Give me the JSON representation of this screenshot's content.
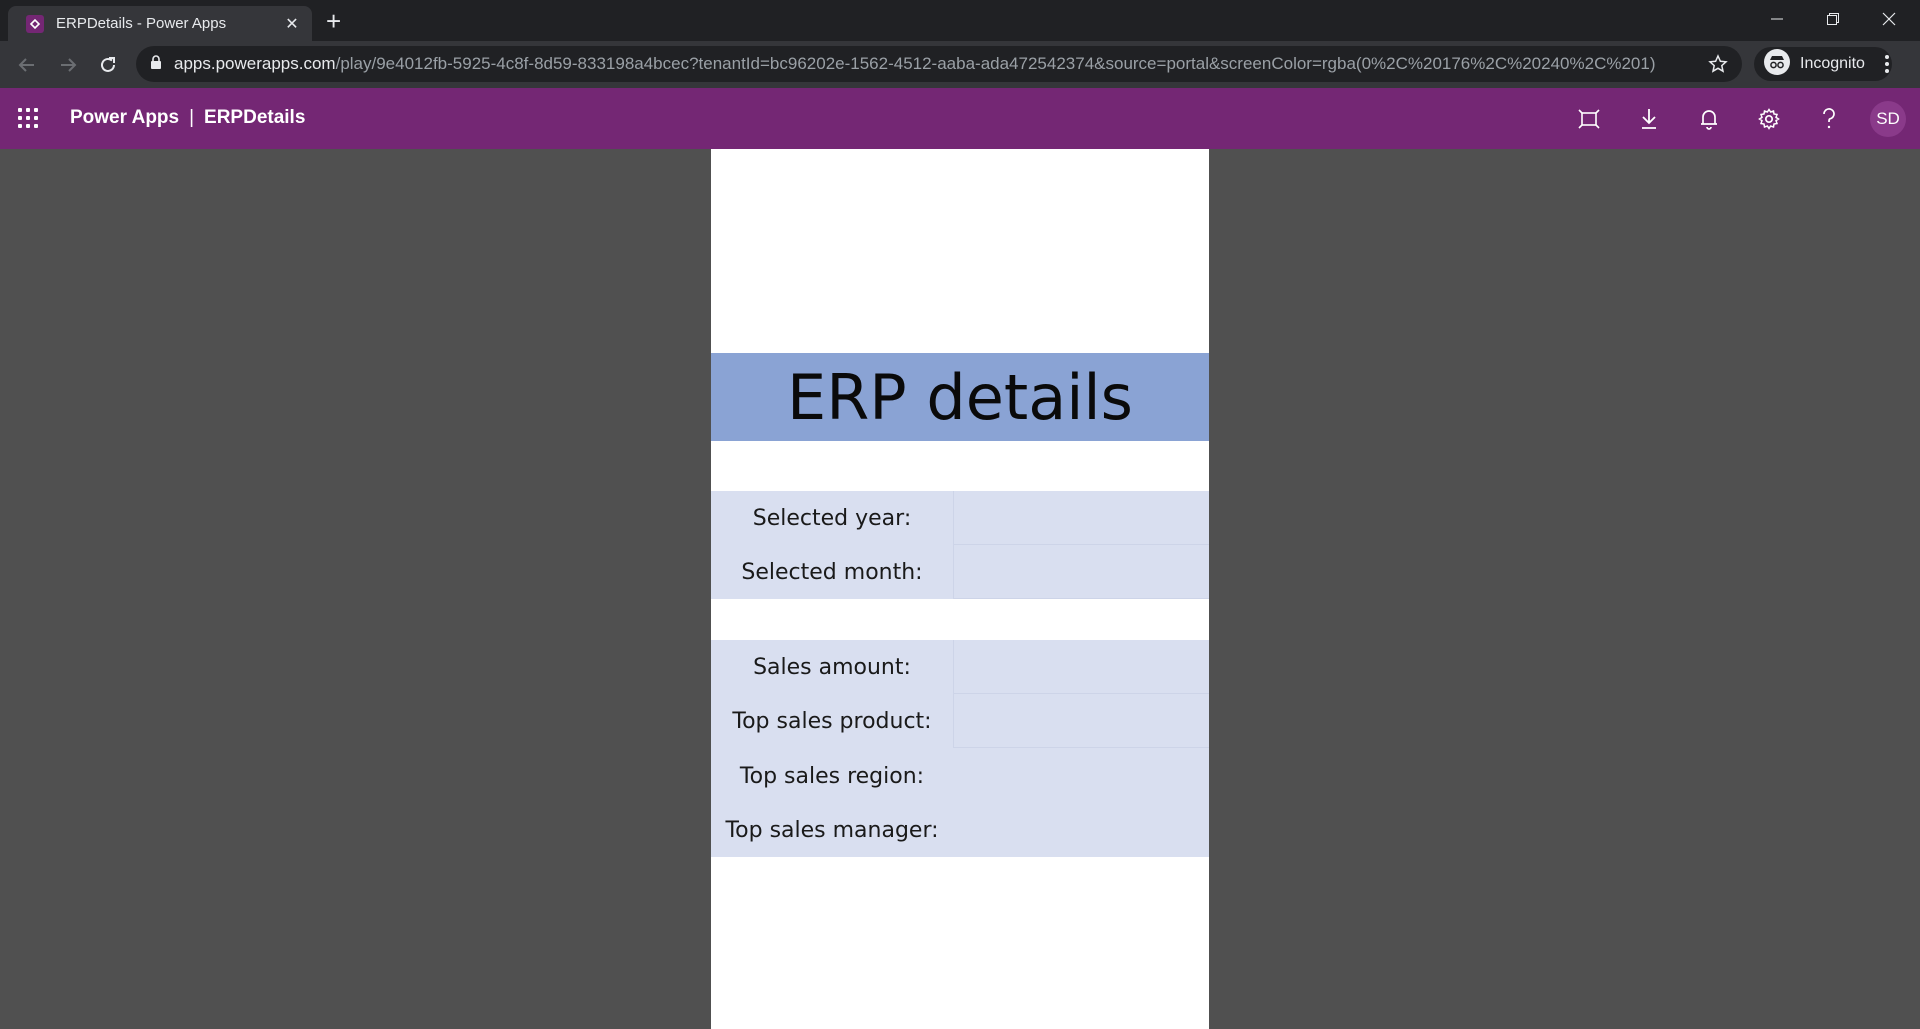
{
  "browser": {
    "tab_title": "ERPDetails - Power Apps",
    "url_host": "apps.powerapps.com",
    "url_path": "/play/9e4012fb-5925-4c8f-8d59-833198a4bcec?tenantId=bc96202e-1562-4512-aaba-ada472542374&source=portal&screenColor=rgba(0%2C%20176%2C%20240%2C%201)",
    "incognito_label": "Incognito"
  },
  "header": {
    "product": "Power Apps",
    "separator": "|",
    "app_name": "ERPDetails",
    "avatar_initials": "SD",
    "accent_color": "#742774"
  },
  "app": {
    "title": "ERP details",
    "title_band_color": "#8aa3d4",
    "panel_color": "#d9dff0",
    "period_fields": [
      {
        "label": "Selected year:",
        "value": ""
      },
      {
        "label": "Selected month:",
        "value": ""
      }
    ],
    "sales_fields": [
      {
        "label": "Sales amount:",
        "value": ""
      },
      {
        "label": "Top sales product:",
        "value": ""
      },
      {
        "label": "Top sales region:",
        "value": ""
      },
      {
        "label": "Top sales manager:",
        "value": ""
      }
    ]
  }
}
